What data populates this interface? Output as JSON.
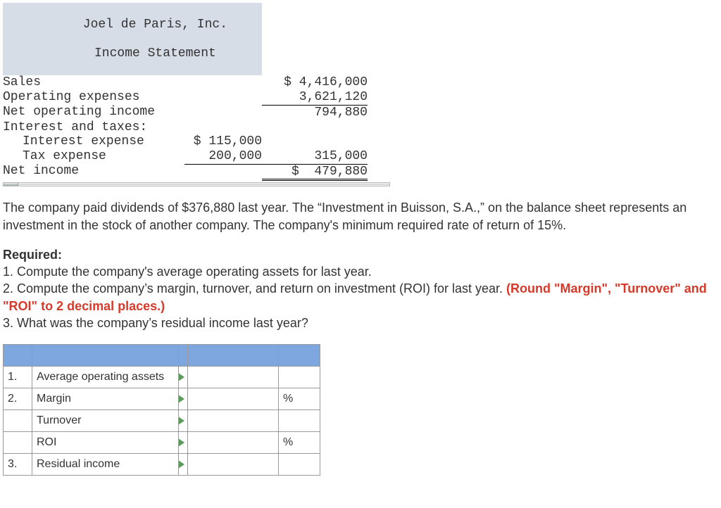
{
  "income": {
    "company": "Joel de Paris, Inc.",
    "title": "Income Statement",
    "rows": {
      "sales_label": "Sales",
      "sales_val": "$ 4,416,000",
      "opex_label": "Operating expenses",
      "opex_val": "3,621,120",
      "noi_label": "Net operating income",
      "noi_val": "794,880",
      "it_label": "Interest and taxes:",
      "intexp_label": "Interest expense",
      "intexp_mid": "$ 115,000",
      "tax_label": "Tax expense",
      "tax_mid": "200,000",
      "it_total": "315,000",
      "ni_label": "Net income",
      "ni_val": "$  479,880"
    }
  },
  "paragraph": "The company paid dividends of $376,880 last year. The “Investment in Buisson, S.A.,” on the balance sheet represents an investment in the stock of another company. The company's minimum required rate of return of 15%.",
  "required": {
    "heading": "Required:",
    "q1": "1. Compute the company's average operating assets for last year.",
    "q2a": "2. Compute the company’s margin, turnover, and return on investment (ROI) for last year. ",
    "q2b": "(Round \"Margin\", \"Turnover\" and \"ROI\" to 2 decimal places.)",
    "q3": "3. What was the company’s residual income last year?"
  },
  "answers": {
    "r1_num": "1.",
    "r1_label": "Average operating assets",
    "r2_num": "2.",
    "r2_label": "Margin",
    "r2_unit": "%",
    "r3_label": "Turnover",
    "r4_label": "ROI",
    "r4_unit": "%",
    "r5_num": "3.",
    "r5_label": "Residual income"
  },
  "chart_data": {
    "type": "table",
    "title": "Joel de Paris, Inc. Income Statement",
    "rows": [
      {
        "item": "Sales",
        "value": 4416000
      },
      {
        "item": "Operating expenses",
        "value": 3621120
      },
      {
        "item": "Net operating income",
        "value": 794880
      },
      {
        "item": "Interest expense",
        "value": 115000
      },
      {
        "item": "Tax expense",
        "value": 200000
      },
      {
        "item": "Interest and taxes total",
        "value": 315000
      },
      {
        "item": "Net income",
        "value": 479880
      }
    ]
  }
}
